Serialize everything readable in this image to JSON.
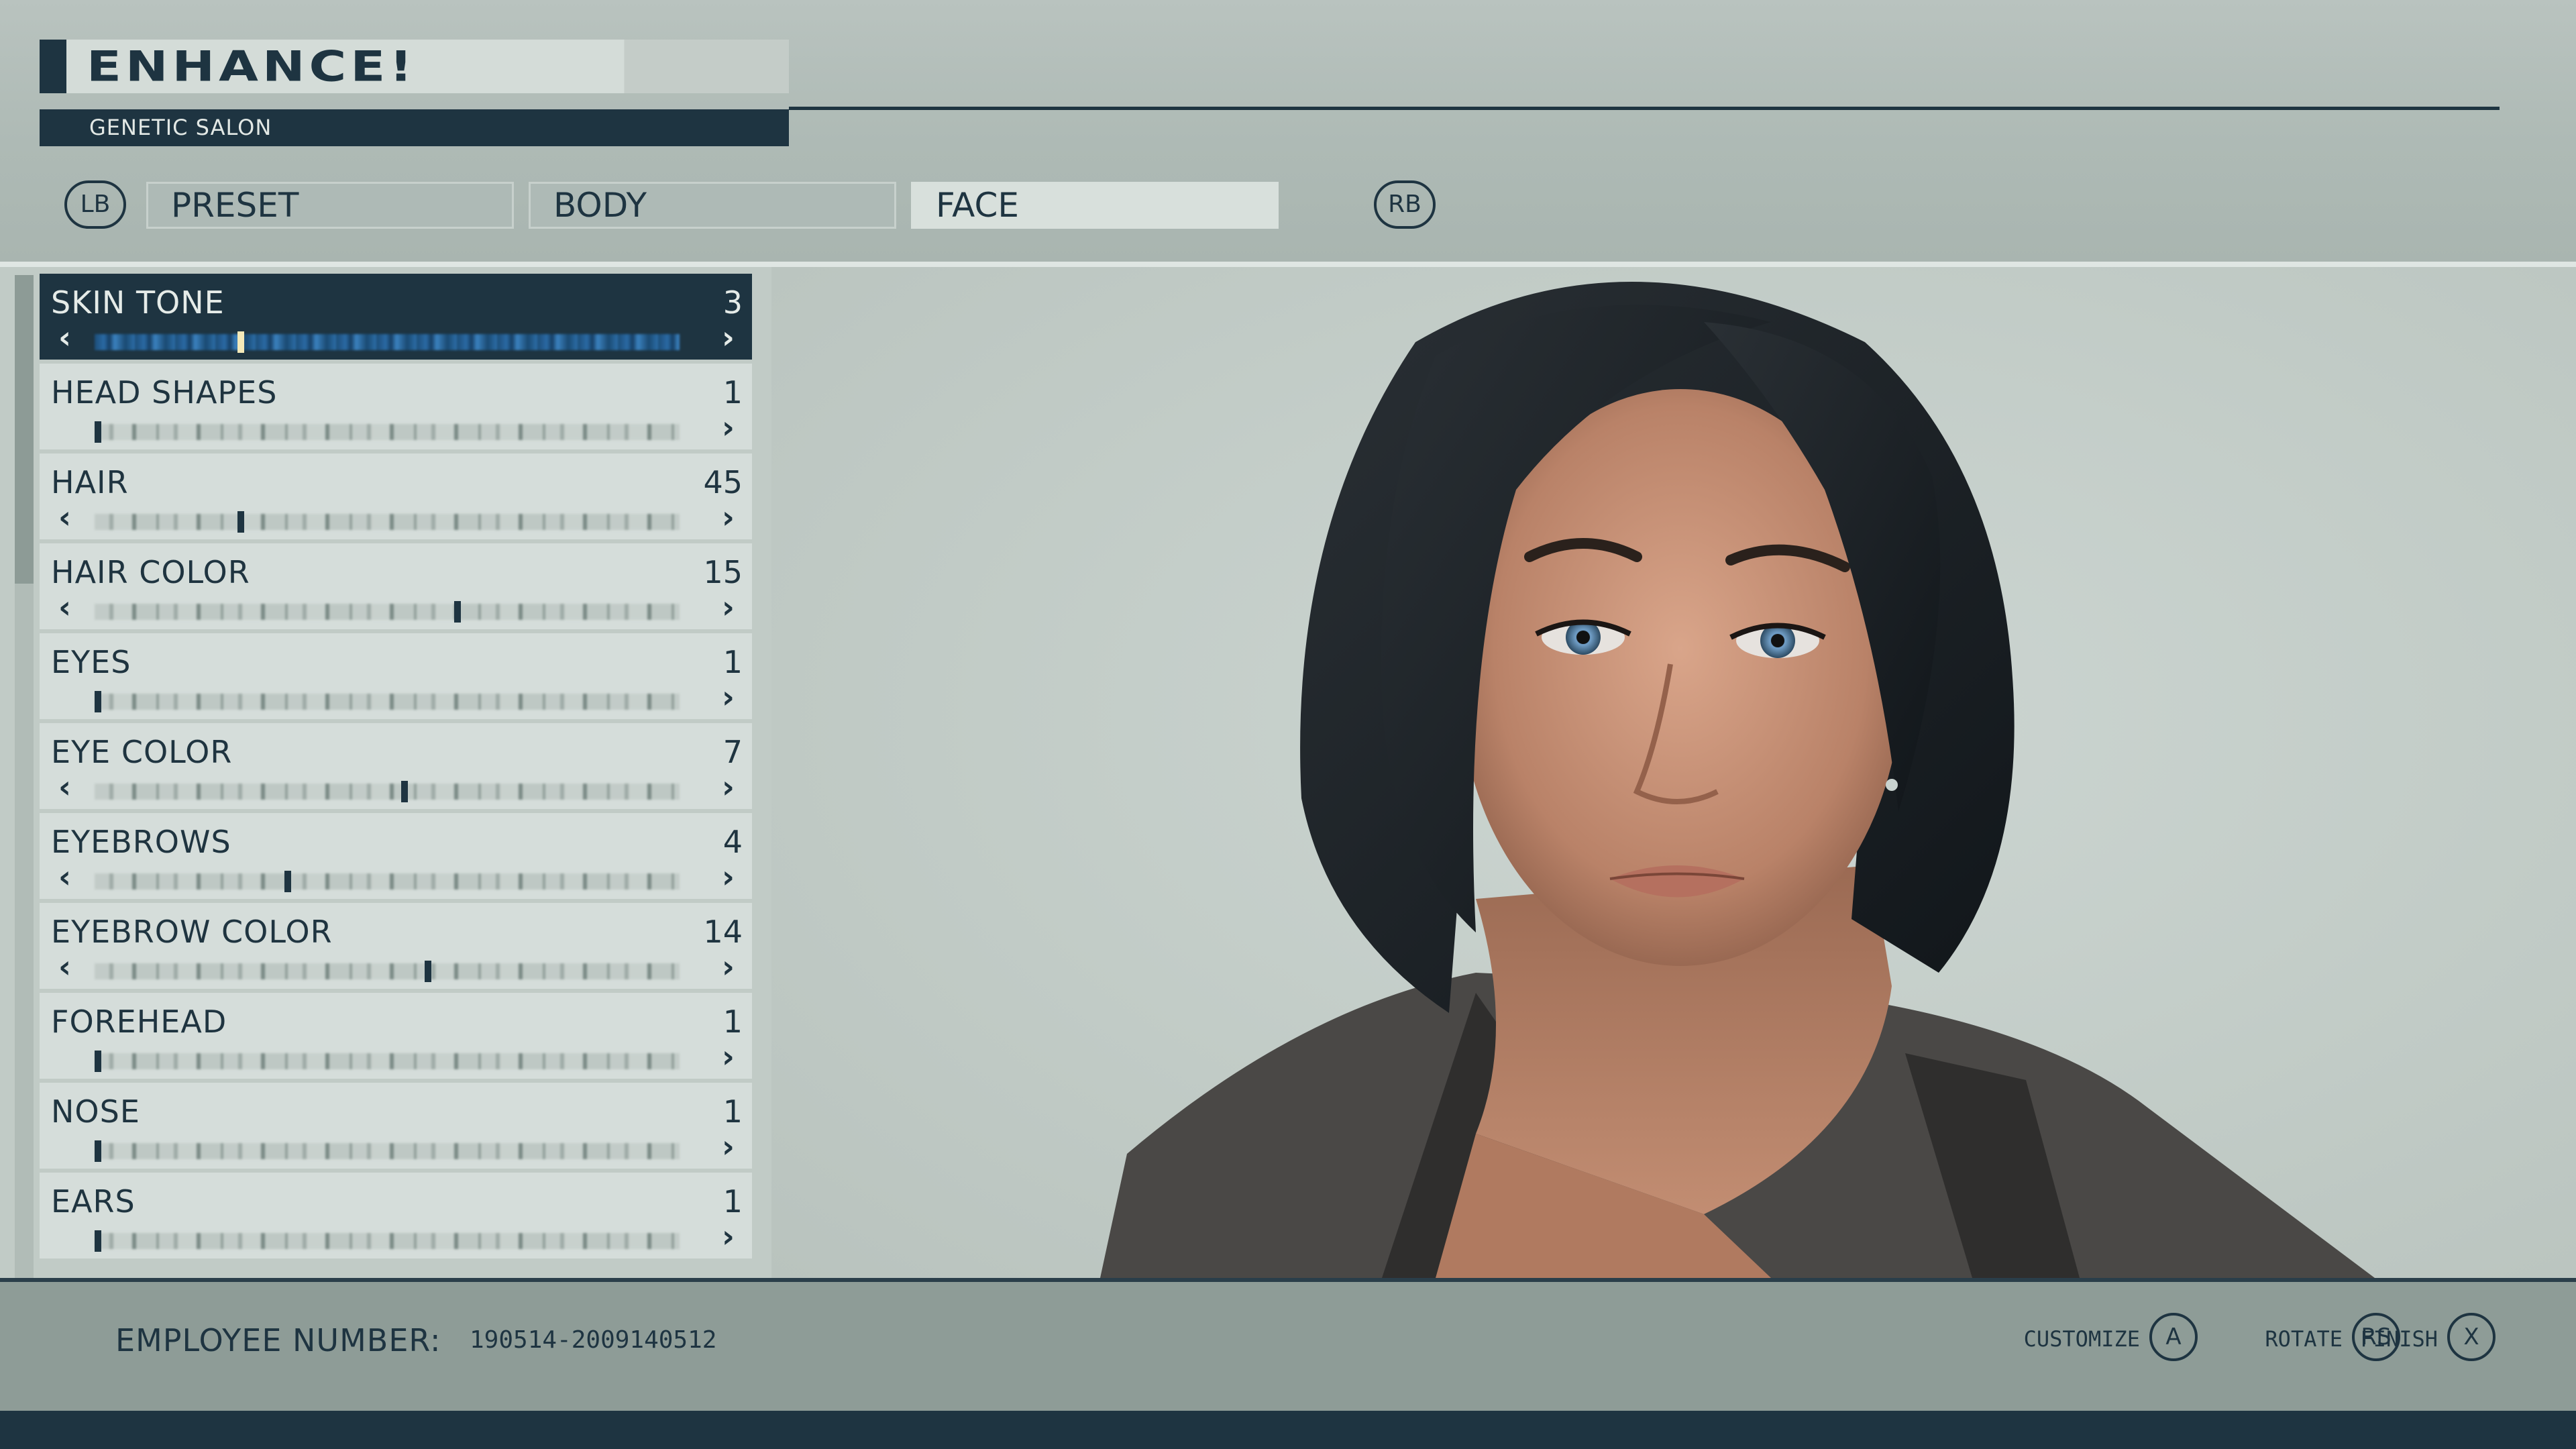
{
  "header": {
    "title": "ENHANCE!",
    "subtitle": "GENETIC SALON"
  },
  "tabs": {
    "prev_bumper": "LB",
    "next_bumper": "RB",
    "items": [
      {
        "label": "PRESET",
        "active": false
      },
      {
        "label": "BODY",
        "active": false
      },
      {
        "label": "FACE",
        "active": true
      }
    ]
  },
  "options": [
    {
      "label": "SKIN TONE",
      "value": "3",
      "selected": true,
      "left_arrow": true,
      "level": 0.25
    },
    {
      "label": "HEAD SHAPES",
      "value": "1",
      "selected": false,
      "left_arrow": false,
      "level": 0.0
    },
    {
      "label": "HAIR",
      "value": "45",
      "selected": false,
      "left_arrow": true,
      "level": 0.25
    },
    {
      "label": "HAIR COLOR",
      "value": "15",
      "selected": false,
      "left_arrow": true,
      "level": 0.62
    },
    {
      "label": "EYES",
      "value": "1",
      "selected": false,
      "left_arrow": false,
      "level": 0.0
    },
    {
      "label": "EYE COLOR",
      "value": "7",
      "selected": false,
      "left_arrow": true,
      "level": 0.53
    },
    {
      "label": "EYEBROWS",
      "value": "4",
      "selected": false,
      "left_arrow": true,
      "level": 0.33
    },
    {
      "label": "EYEBROW COLOR",
      "value": "14",
      "selected": false,
      "left_arrow": true,
      "level": 0.57
    },
    {
      "label": "FOREHEAD",
      "value": "1",
      "selected": false,
      "left_arrow": false,
      "level": 0.0
    },
    {
      "label": "NOSE",
      "value": "1",
      "selected": false,
      "left_arrow": false,
      "level": 0.0
    },
    {
      "label": "EARS",
      "value": "1",
      "selected": false,
      "left_arrow": false,
      "level": 0.0
    }
  ],
  "arrows": {
    "left": "‹",
    "right": "›"
  },
  "footer": {
    "employee_label": "EMPLOYEE NUMBER:",
    "employee_number": "190514-2009140512",
    "hints": [
      {
        "label": "CUSTOMIZE",
        "button": "A"
      },
      {
        "label": "ROTATE",
        "button": "RS"
      },
      {
        "label": "FINISH",
        "button": "X"
      }
    ]
  },
  "colors": {
    "accent_dark": "#1e3441",
    "panel_light": "#d5ddda",
    "selected_slider": "#2a6aa4"
  },
  "icons": {
    "portrait": "character-portrait",
    "arrow_left": "chevron-left-icon",
    "arrow_right": "chevron-right-icon"
  }
}
